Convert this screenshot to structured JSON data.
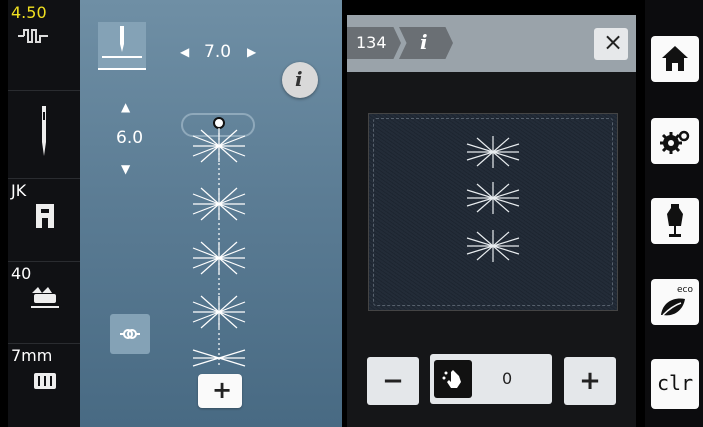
{
  "left_bar": {
    "stitch_width_value": "4.50",
    "presser_foot_label": "JK",
    "tension_value": "40",
    "buttonhole_value": "7mm"
  },
  "stitch_panel": {
    "stitch_length": "7.0",
    "stitch_position": "6.0",
    "add_label": "+"
  },
  "info_panel": {
    "stitch_number": "134",
    "info_tab_label": "i",
    "counter_value": "0",
    "minus_label": "−",
    "plus_label": "+",
    "close_label": "×"
  },
  "right_bar": {
    "clr_label": "clr",
    "eco_label": "eco"
  },
  "colors": {
    "main_bg": "#5a7b93",
    "panel_header": "#9aa3aa",
    "accent_yellow": "#f0e020"
  }
}
